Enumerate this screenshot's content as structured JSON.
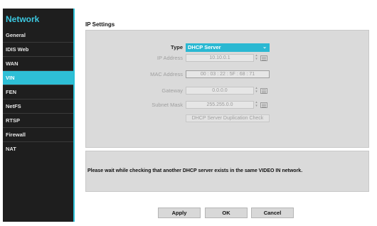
{
  "sidebar": {
    "title": "Network",
    "items": [
      {
        "label": "General"
      },
      {
        "label": "IDIS Web"
      },
      {
        "label": "WAN"
      },
      {
        "label": "VIN"
      },
      {
        "label": "FEN"
      },
      {
        "label": "NetFS"
      },
      {
        "label": "RTSP"
      },
      {
        "label": "Firewall"
      },
      {
        "label": "NAT"
      }
    ],
    "active": "VIN",
    "accent_color": "#2ebfd6"
  },
  "ip_settings": {
    "title": "IP Settings",
    "type_label": "Type",
    "type_value": "DHCP Server",
    "ip_address_label": "IP Address",
    "ip_address_value": "10.10.0.1",
    "mac_address_label": "MAC Address",
    "mac_address_value": "00 : 03 : 22 : 5F : 68 : 71",
    "gateway_label": "Gateway",
    "gateway_value": "0.0.0.0",
    "subnet_mask_label": "Subnet Mask",
    "subnet_mask_value": "255.255.0.0",
    "duplication_check_label": "DHCP Server Duplication Check"
  },
  "message": {
    "text": "Please wait while checking that another DHCP server exists in the same VIDEO IN network."
  },
  "footer": {
    "apply_label": "Apply",
    "ok_label": "OK",
    "cancel_label": "Cancel"
  },
  "icons": {
    "spin": "up-down-spinner-icon",
    "keyboard": "keyboard-icon",
    "dropdown": "chevron-down-icon"
  }
}
